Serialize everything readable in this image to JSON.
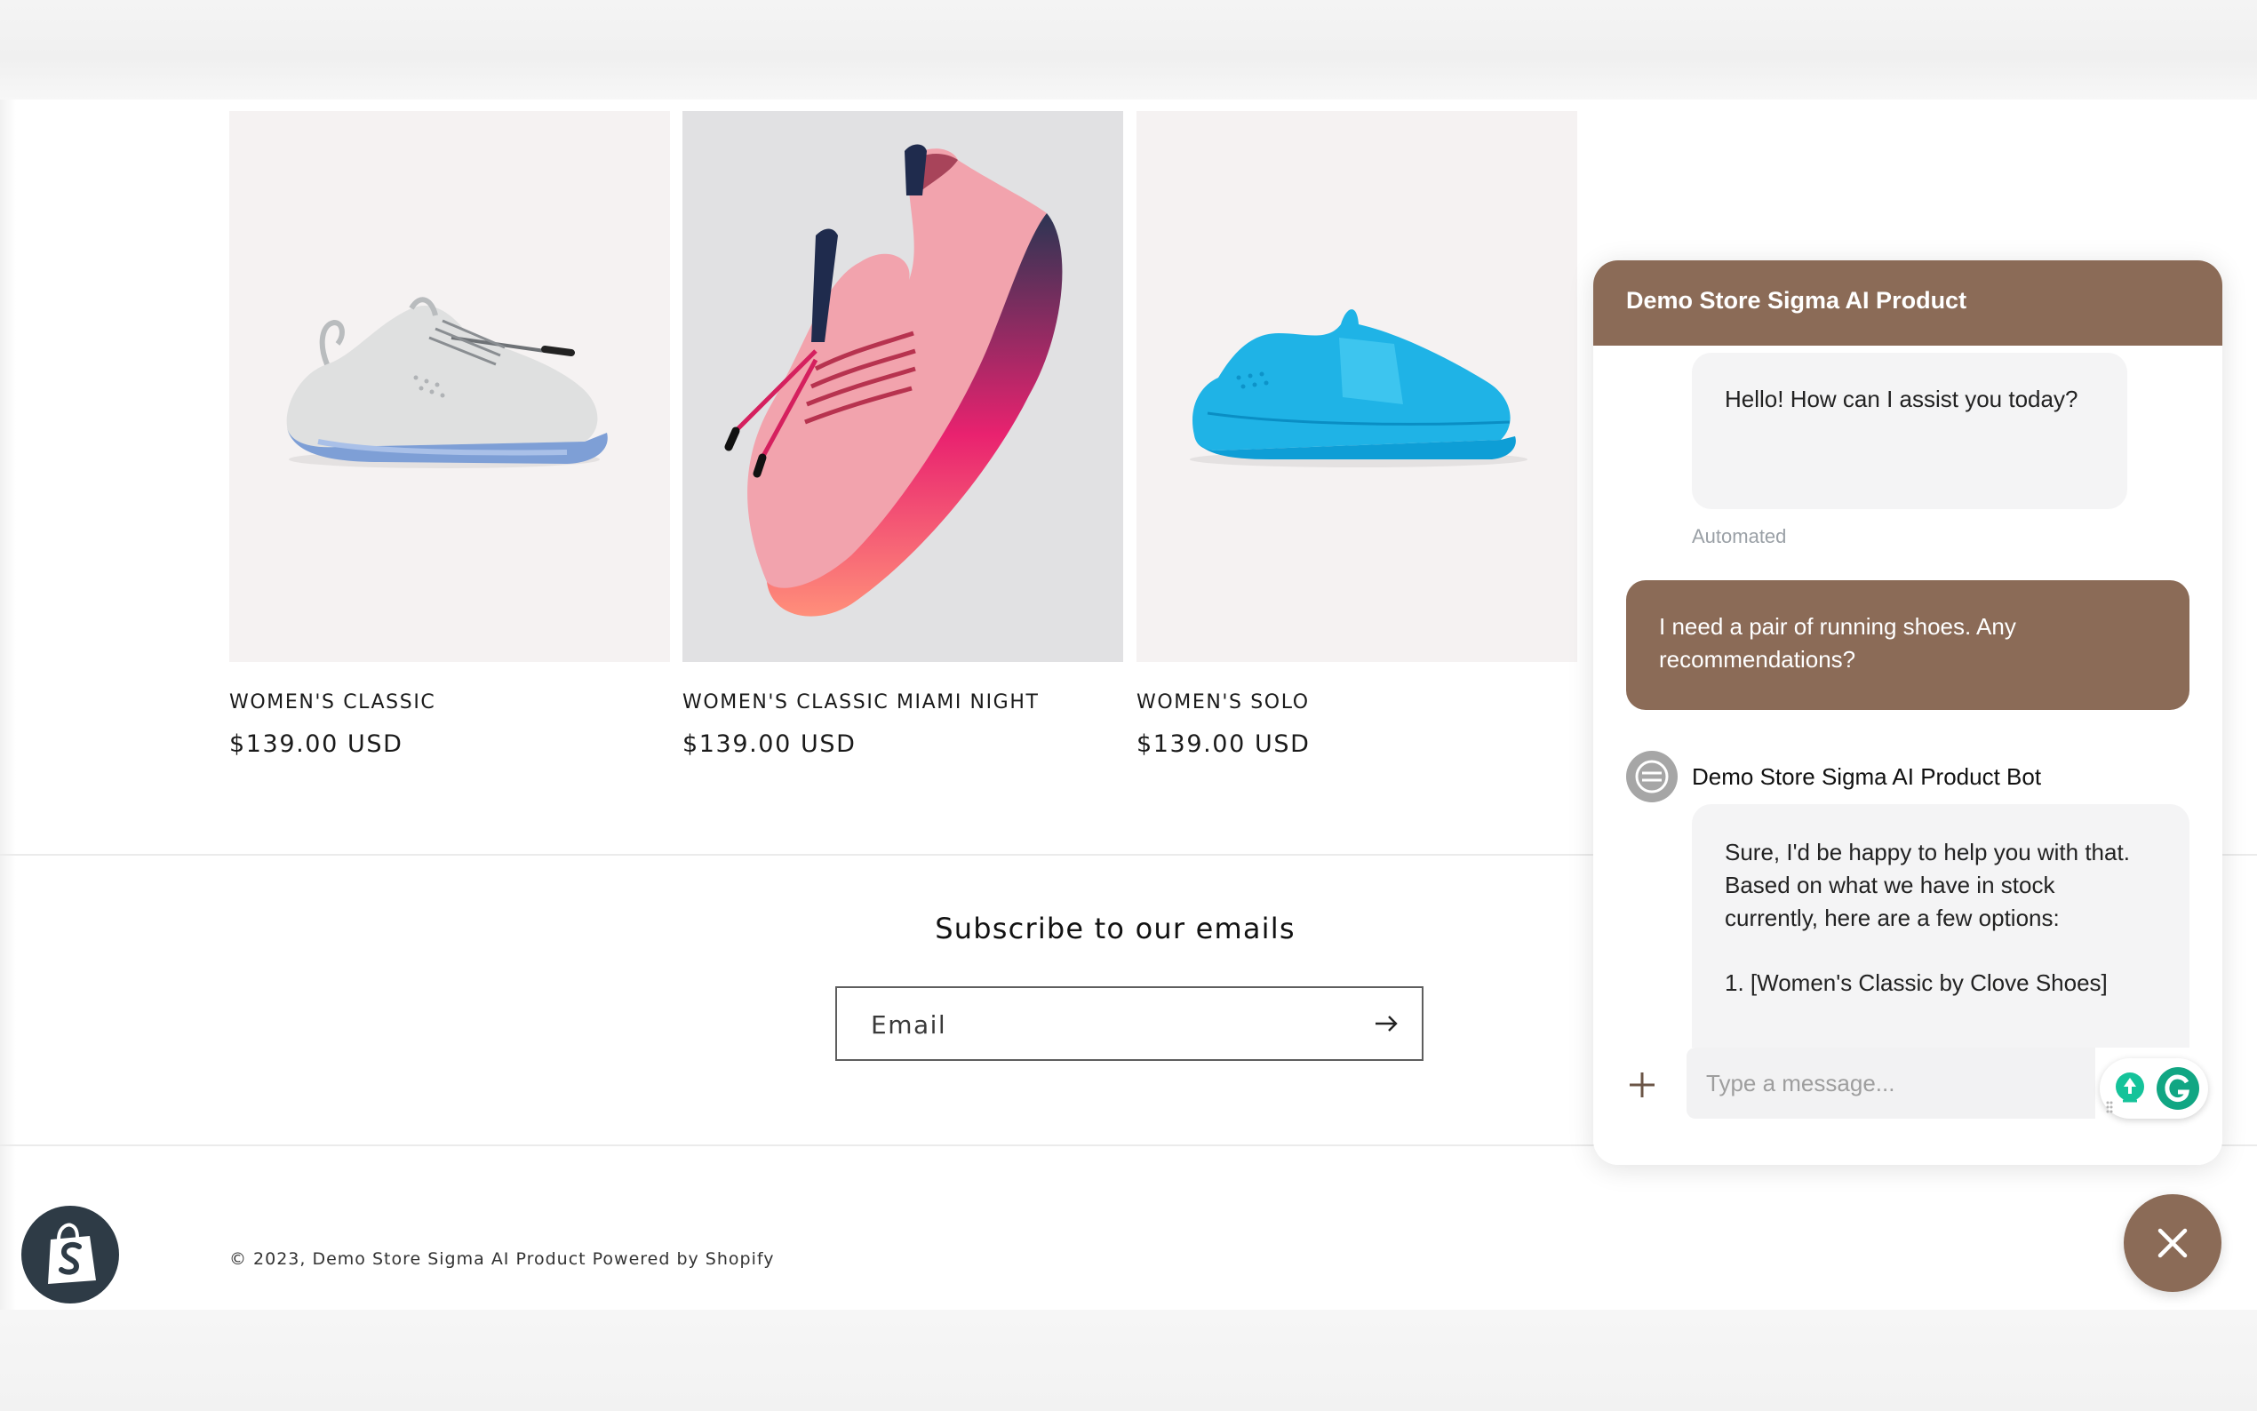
{
  "products": [
    {
      "title": "WOMEN'S CLASSIC",
      "price": "$139.00 USD",
      "image_icon": "grey-blue-sneaker-image"
    },
    {
      "title": "WOMEN'S CLASSIC MIAMI NIGHT",
      "price": "$139.00 USD",
      "image_icon": "pink-navy-sneaker-image"
    },
    {
      "title": "WOMEN'S SOLO",
      "price": "$139.00 USD",
      "image_icon": "cyan-slip-on-sneaker-image"
    }
  ],
  "newsletter": {
    "heading": "Subscribe to our emails",
    "email_placeholder": "Email",
    "submit_icon": "arrow-right-icon"
  },
  "footer": {
    "copyright": "© 2023, Demo Store Sigma AI Product Powered by Shopify"
  },
  "chat": {
    "header_title": "Demo Store Sigma AI Product",
    "messages": [
      {
        "role": "bot",
        "text": "Hello! How can I assist you today?",
        "meta": "Automated"
      },
      {
        "role": "user",
        "line1": "I need a pair of running shoes. Any",
        "line2": "recommendations?"
      },
      {
        "role": "bot",
        "sender": "Demo Store Sigma AI Product Bot",
        "line1": "Sure, I'd be happy to help you with that.",
        "line2": "Based on what we have in stock",
        "line3": "currently, here are a few options:",
        "line4": "1. [Women's Classic by Clove Shoes]"
      }
    ],
    "input_placeholder": "Type a message...",
    "attach_icon": "plus-icon",
    "close_icon": "close-icon"
  },
  "colors": {
    "accent": "#8b6b57",
    "bubble_bot": "#f4f4f5",
    "grammarly": "#15c39a"
  },
  "shopify_badge_icon": "shopify-bag-icon"
}
